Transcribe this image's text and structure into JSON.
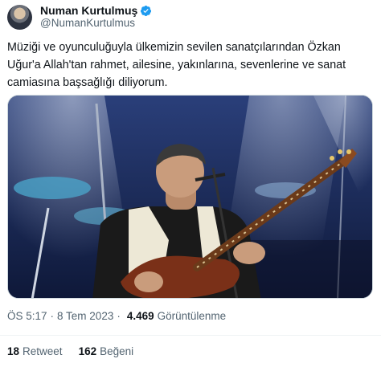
{
  "author": {
    "display_name": "Numan Kurtulmuş",
    "handle": "@NumanKurtulmus",
    "verified_icon": "verified-badge-icon",
    "verified_color": "#1d9bf0"
  },
  "tweet": {
    "text": "Müziği ve oyunculuğuyla ülkemizin sevilen sanatçılarından Özkan Uğur'a Allah'tan rahmet, ailesine, yakınlarına, sevenlerine ve sanat camiasına başsağlığı diliyorum.",
    "time": "ÖS 5:17",
    "separator": "·",
    "date": "8 Tem 2023",
    "views_count": "4.469",
    "views_label": "Görüntülenme"
  },
  "stats": {
    "retweets_count": "18",
    "retweets_label": "Retweet",
    "likes_count": "162",
    "likes_label": "Beğeni"
  },
  "colors": {
    "text": "#0f1419",
    "secondary": "#536471",
    "stage_blue": "#1b2d5c"
  }
}
